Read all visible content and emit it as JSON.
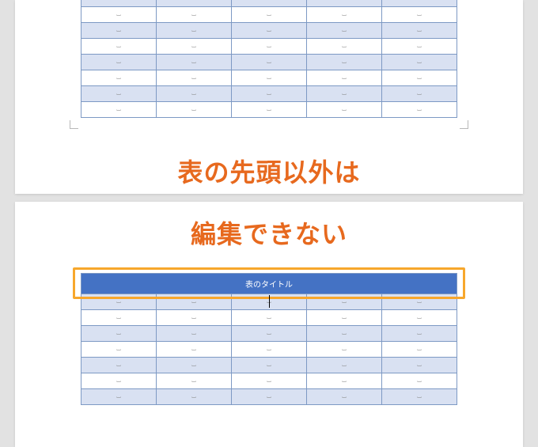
{
  "annotation": {
    "line1": "表の先頭以外は",
    "line2": "編集できない"
  },
  "tableTop": {
    "rows": 8,
    "columns": 5,
    "cellMark": "⌴"
  },
  "tableBottom": {
    "headerTitle": "表のタイトル",
    "rows": 7,
    "columns": 5,
    "cellMark": "⌴"
  },
  "colors": {
    "accent": "#e7691e",
    "highlight": "#f7a72c",
    "tableHeader": "#4472c4",
    "tableBand": "#d9e1f2"
  }
}
